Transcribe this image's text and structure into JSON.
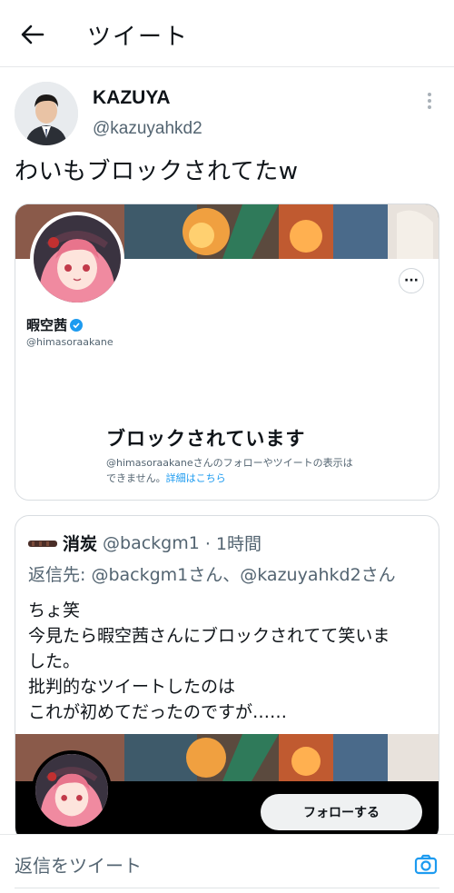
{
  "header": {
    "title": "ツイート",
    "back_icon": "back-arrow-icon"
  },
  "tweet": {
    "author_name": "KAZUYA",
    "author_handle": "@kazuyahkd2",
    "text": "わいもブロックされてたw"
  },
  "profile_card": {
    "name": "暇空茜",
    "handle": "@himasoraakane",
    "more_label": "···",
    "blocked_title": "ブロックされています",
    "blocked_desc_prefix": "@himasoraakaneさんのフォローやツイートの表示は",
    "blocked_desc_line2": "できません。",
    "blocked_link": "詳細はこちら"
  },
  "quoted_tweet": {
    "author_name": "消炭",
    "author_handle": "@backgm1",
    "time": "· 1時間",
    "reply_to": "返信先: @backgm1さん、@kazuyahkd2さん",
    "lines": [
      "ちょ笑",
      "今見たら暇空茜さんにブロックされてて笑いま",
      "した。",
      "批判的なツイートしたのは",
      "これが初めてだったのですが……"
    ],
    "follow_button": "フォローする"
  },
  "reply": {
    "placeholder": "返信をツイート",
    "camera_icon": "camera-icon"
  },
  "colors": {
    "accent": "#1d9bf0",
    "text": "#0f1419",
    "secondary": "#536471",
    "border": "#d9dde1"
  }
}
